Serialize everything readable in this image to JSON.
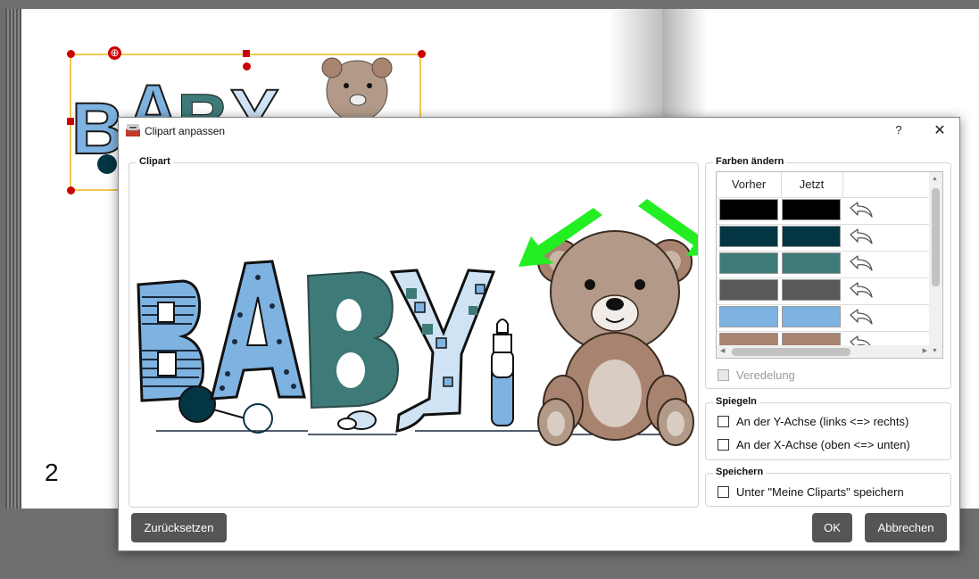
{
  "page": {
    "number": "2"
  },
  "dialog": {
    "title": "Clipart anpassen",
    "help_label": "?",
    "close_label": "✕"
  },
  "clipart_group": {
    "title": "Clipart",
    "artwork_text": "BABY"
  },
  "colors_group": {
    "title": "Farben ändern",
    "columns": [
      "Vorher",
      "Jetzt"
    ],
    "rows": [
      {
        "before": "#000000",
        "now": "#000000"
      },
      {
        "before": "#033542",
        "now": "#033542"
      },
      {
        "before": "#3e7a78",
        "now": "#3e7a78"
      },
      {
        "before": "#58595b",
        "now": "#58595b"
      },
      {
        "before": "#7eb2e0",
        "now": "#7eb2e0"
      },
      {
        "before": "#a88370",
        "now": "#a88370"
      }
    ],
    "refinement_label": "Veredelung"
  },
  "mirror_group": {
    "title": "Spiegeln",
    "y_axis_label": "An der Y-Achse (links <=> rechts)",
    "x_axis_label": "An der X-Achse (oben <=> unten)"
  },
  "save_group": {
    "title": "Speichern",
    "save_label": "Unter \"Meine Cliparts\" speichern"
  },
  "buttons": {
    "reset": "Zurücksetzen",
    "ok": "OK",
    "cancel": "Abbrechen"
  },
  "colors": {
    "button_bg": "#555555",
    "selection_frame": "#f2c94c",
    "handle": "#cc0000",
    "annotation_arrow": "#22ee22"
  }
}
